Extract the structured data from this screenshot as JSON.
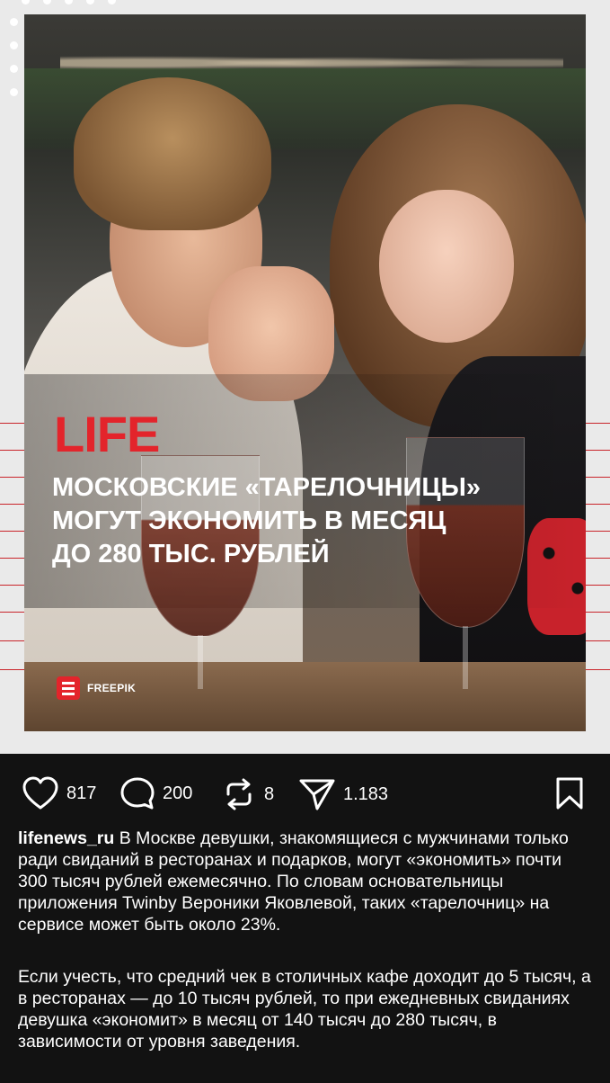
{
  "post": {
    "brand": "LIFE",
    "headline_lines": [
      "МОСКОВСКИЕ «ТАРЕЛОЧНИЦЫ»",
      "МОГУТ ЭКОНОМИТЬ В МЕСЯЦ",
      "ДО 280 ТЫС. РУБЛЕЙ"
    ],
    "credit": "FREEPIK",
    "accent_color": "#e3242b"
  },
  "actions": {
    "likes": "817",
    "comments": "200",
    "reposts": "8",
    "shares": "1.183"
  },
  "caption": {
    "username": "lifenews_ru",
    "paragraph1": "В Москве девушки, знакомящиеся с мужчинами только ради свиданий в ресторанах и подарков, могут «экономить» почти 300 тысяч рублей ежемесячно. По словам основательницы приложения Twinby Вероники Яковлевой, таких «тарелочниц» на сервисе может быть около 23%.",
    "paragraph2": "Если учесть, что средний чек в столичных кафе доходит до 5 тысяч, а в ресторанах — до 10 тысяч рублей, то при ежедневных свиданиях девушка «экономит» в месяц от 140 тысяч до 280 тысяч, в зависимости от уровня заведения."
  },
  "icons": [
    "heart-icon",
    "comment-icon",
    "repost-icon",
    "send-icon",
    "bookmark-icon"
  ]
}
